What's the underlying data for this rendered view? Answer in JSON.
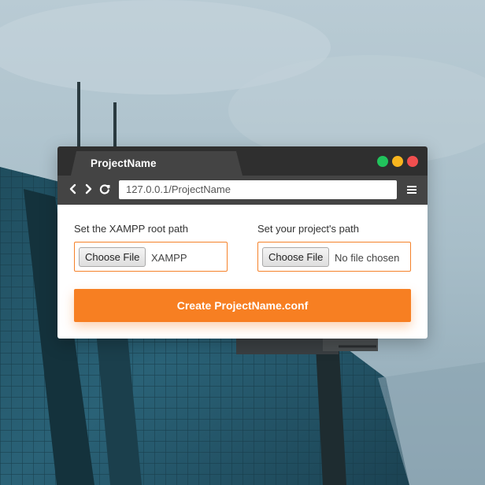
{
  "window": {
    "tab_title": "ProjectName",
    "address_url": "127.0.0.1/ProjectName",
    "controls": [
      "green-dot",
      "yellow-dot",
      "red-dot"
    ],
    "nav_icons": [
      "back-arrow-icon",
      "forward-arrow-icon",
      "reload-icon",
      "hamburger-menu-icon"
    ]
  },
  "form": {
    "xampp_label": "Set the XAMPP root path",
    "xampp_button": "Choose File",
    "xampp_value": "XAMPP",
    "project_label": "Set your project's path",
    "project_button": "Choose File",
    "project_value": "No file chosen",
    "submit_label": "Create ProjectName.conf"
  },
  "colors": {
    "accent": "#f77f22",
    "titlebar": "#2f2f2f",
    "toolbar": "#444444",
    "green": "#21c35c",
    "yellow": "#f8b51e",
    "red": "#f14f4f"
  }
}
